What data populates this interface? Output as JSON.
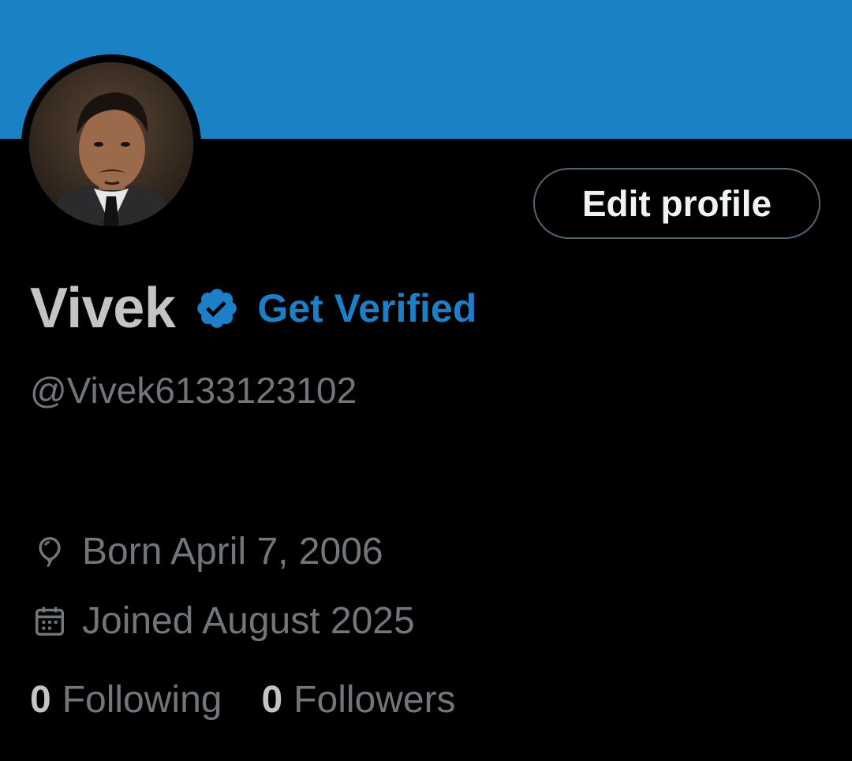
{
  "colors": {
    "banner": "#1a82c4",
    "background": "#000000",
    "accent": "#1d7fc7",
    "muted_text": "#71767b"
  },
  "profile": {
    "name": "Vivek",
    "handle": "@Vivek6133123102",
    "verified_icon": "verified-badge-icon",
    "get_verified_label": "Get Verified",
    "edit_profile_label": "Edit profile",
    "avatar_alt": "profile photo"
  },
  "details": {
    "born_icon": "balloon-icon",
    "born_text": "Born April 7, 2006",
    "joined_icon": "calendar-icon",
    "joined_text": "Joined August 2025"
  },
  "stats": {
    "following_count": "0",
    "following_label": "Following",
    "followers_count": "0",
    "followers_label": "Followers"
  }
}
